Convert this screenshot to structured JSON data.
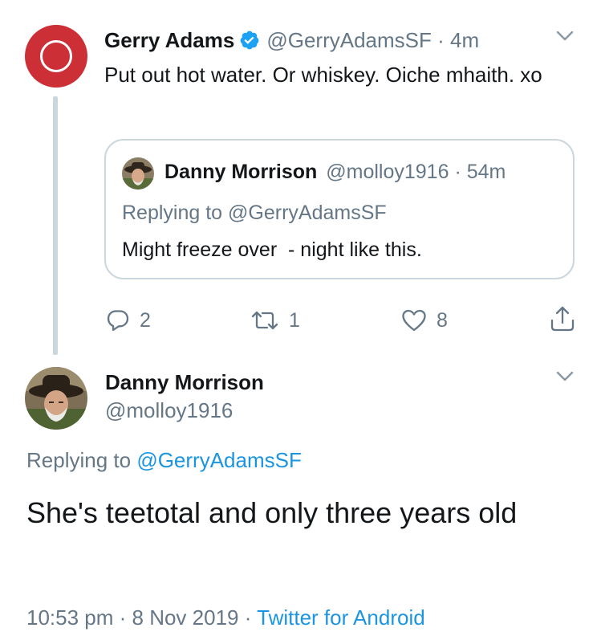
{
  "parent_tweet": {
    "author_name": "Gerry Adams",
    "verified": true,
    "handle": "@GerryAdamsSF",
    "separator": " · ",
    "time": "4m",
    "text": "Put out hot water. Or whiskey. Oiche mhaith. xo",
    "quoted": {
      "author_name": "Danny Morrison",
      "handle": "@molloy1916",
      "separator": " · ",
      "time": "54m",
      "replying_prefix": "Replying to ",
      "replying_to": "@GerryAdamsSF",
      "text": "Might freeze over  - night like this."
    },
    "actions": {
      "replies": "2",
      "retweets": "1",
      "likes": "8"
    }
  },
  "main_tweet": {
    "author_name": "Danny Morrison",
    "handle": "@molloy1916",
    "replying_prefix": "Replying to ",
    "replying_to": "@GerryAdamsSF",
    "text": "She's teetotal and only three years old",
    "time": "10:53 pm",
    "separator": " · ",
    "date": "8 Nov 2019",
    "separator2": " · ",
    "source": "Twitter for Android"
  },
  "colors": {
    "accent": "#1b95e0",
    "muted": "#657786",
    "avatar_red": "#cc2f36",
    "thread_line": "#ccd6dd"
  },
  "icons": {
    "verified": "verified-badge-icon",
    "menu": "chevron-down-icon",
    "reply": "reply-bubble-icon",
    "retweet": "retweet-icon",
    "like": "heart-icon",
    "share": "share-icon"
  }
}
